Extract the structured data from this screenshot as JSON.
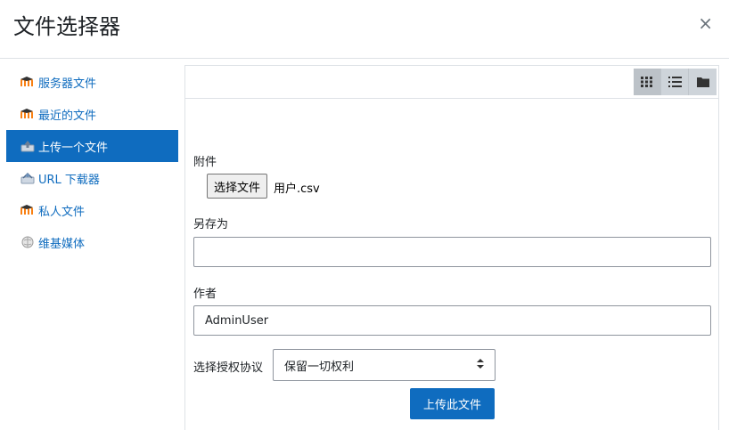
{
  "dialog": {
    "title": "文件选择器",
    "close_label": "×"
  },
  "sidebar": {
    "items": [
      {
        "label": "服务器文件",
        "icon": "moodle-icon",
        "active": false
      },
      {
        "label": "最近的文件",
        "icon": "moodle-icon",
        "active": false
      },
      {
        "label": "上传一个文件",
        "icon": "upload-icon",
        "active": true
      },
      {
        "label": "URL 下载器",
        "icon": "url-icon",
        "active": false
      },
      {
        "label": "私人文件",
        "icon": "moodle-icon",
        "active": false
      },
      {
        "label": "维基媒体",
        "icon": "wikimedia-icon",
        "active": false
      }
    ]
  },
  "toolbar": {
    "views": [
      "icons-view",
      "list-view",
      "tree-view"
    ],
    "active_view": "icons-view"
  },
  "form": {
    "attachment_label": "附件",
    "choose_file_button": "选择文件",
    "chosen_file": "用户.csv",
    "save_as_label": "另存为",
    "save_as_value": "",
    "author_label": "作者",
    "author_value": "AdminUser",
    "license_label": "选择授权协议",
    "license_value": "保留一切权利",
    "upload_button": "上传此文件"
  },
  "colors": {
    "accent": "#0f6cbf",
    "icon_orange": "#f98012"
  }
}
